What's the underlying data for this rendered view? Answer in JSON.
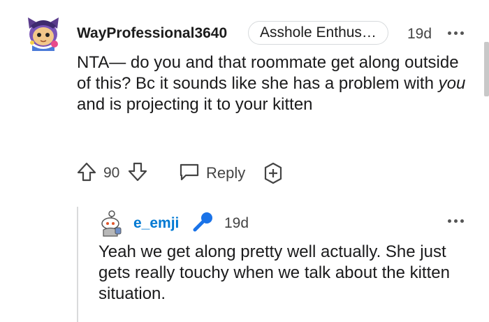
{
  "comment": {
    "username": "WayProfessional3640",
    "flair": "Asshole Enthus…",
    "time": "19d",
    "body_before": "NTA— do you and that roommate get along outside of this? Bc it sounds like she has a problem with ",
    "body_emphasis": "you",
    "body_after": " and is projecting it to your kitten",
    "score": "90",
    "reply_label": "Reply",
    "avatar_icon": "snoo-avatar-icon"
  },
  "reply": {
    "username": "e_emji",
    "badge_icon": "microphone-icon",
    "time": "19d",
    "body": "Yeah we get along pretty well actually. She just gets really touchy when we talk about the kitten situation."
  },
  "colors": {
    "username_reply": "#0079d3",
    "meta_text": "#444444",
    "thread_line": "#d9dadb",
    "badge_blue": "#1a73e8"
  }
}
